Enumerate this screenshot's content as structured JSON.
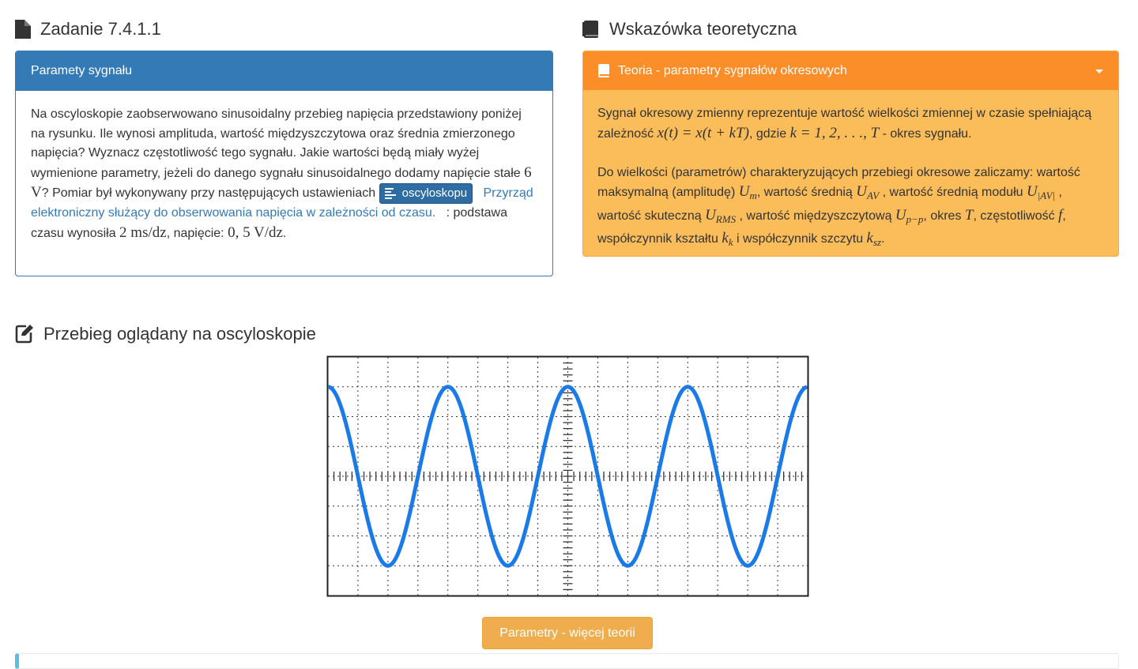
{
  "task": {
    "title": "Zadanie 7.4.1.1",
    "panel_title": "Paramety sygnału",
    "body_part1": "Na oscyloskopie zaobserwowano sinusoidalny przebieg napięcia przedstawiony poniżej na rysunku. Ile wynosi amplituda, wartość międzyszczytowa oraz średnia zmierzonego napięcia? Wyznacz częstotliwość tego sygnału. Jakie wartości będą miały wyżej wymienione parametry, jeżeli do danego sygnału sinusoidalnego dodamy napięcie stałe ",
    "dc_voltage": "6 V",
    "body_part2": "? Pomiar był wykonywany przy następujących ustawieniach ",
    "tag_label": "oscyloskopu",
    "tag_description": "Przyrząd elektroniczny służący do obserwowania napięcia w zależności od czasu.",
    "body_part3": " : podstawa czasu wynosiła ",
    "timebase": "2 ms/dz",
    "body_part4": ", napięcie: ",
    "voltage_div": "0, 5 V/dz",
    "body_end": "."
  },
  "hint": {
    "title": "Wskazówka teoretyczna",
    "panel_title": "Teoria - parametry sygnałów okresowych",
    "p1_a": "Sygnał okresowy zmienny reprezentuje wartość wielkości zmiennej w czasie spełniającą zależność ",
    "p1_formula": "x(t) = x(t + kT)",
    "p1_b": ", gdzie ",
    "p1_k": "k = 1, 2, . . ., T",
    "p1_c": " - okres sygnału.",
    "p2_a": "Do wielkości (parametrów) charakteryzujących przebiegi okresowe zaliczamy: wartość maksymalną (amplitudę) ",
    "p2_b": ", wartość średnią ",
    "p2_c": " , wartość średnią modułu ",
    "p2_d": " , wartość skuteczną ",
    "p2_e": " , wartość międzyszczytową ",
    "p2_f": ", okres ",
    "p2_g": ", częstotliwość ",
    "p2_h": ", współczynnik kształtu ",
    "p2_i": " i współczynnik szczytu ",
    "p2_j": ".",
    "sym_U": "U",
    "sub_m": "m",
    "sub_AV": "AV",
    "sub_absAV": "|AV|",
    "sub_RMS": "RMS",
    "sub_pp": "p−p",
    "sym_T": "T",
    "sym_f": "f",
    "sym_k": "k",
    "sub_k": "k",
    "sub_sz": "sz"
  },
  "scope_section": {
    "title": "Przebieg oglądany na oscyloskopie",
    "more_button": "Parametry - więcej teorii"
  },
  "colors": {
    "primary": "#337ab7",
    "warning_head": "#fb8e29",
    "warning_body": "#fbbc5a",
    "button": "#f0ad4e",
    "trace": "#1a7be8"
  },
  "icons": {
    "task": "file-icon",
    "hint": "book-icon",
    "scope": "edit-icon",
    "tag": "align-left-icon",
    "collapse": "caret-down-icon"
  }
}
